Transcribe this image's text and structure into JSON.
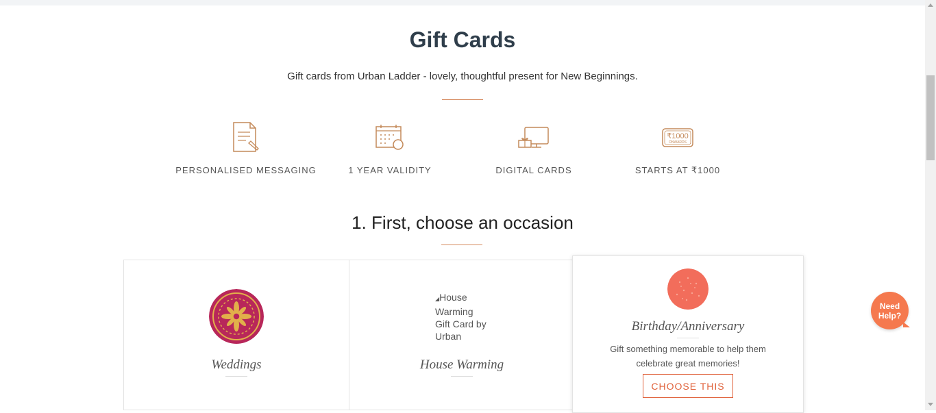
{
  "header": {
    "title": "Gift Cards",
    "subtitle": "Gift cards from Urban Ladder - lovely, thoughtful present for New Beginnings."
  },
  "features": [
    {
      "label": "PERSONALISED MESSAGING",
      "icon": "document-pen-icon"
    },
    {
      "label": "1 YEAR VALIDITY",
      "icon": "calendar-clock-icon"
    },
    {
      "label": "DIGITAL CARDS",
      "icon": "monitor-gift-icon"
    },
    {
      "label": "STARTS AT ₹1000",
      "icon": "price-tag-icon",
      "tag_text": "₹1000",
      "tag_sub": "ONWARDS"
    }
  ],
  "occasion": {
    "step_title": "1. First, choose an occasion",
    "cards": [
      {
        "name": "Weddings",
        "image_color": "#b8275a"
      },
      {
        "name": "House Warming",
        "image_alt": "House Warming Gift Card by Urban"
      },
      {
        "name": "Birthday/Anniversary",
        "description_line1": "Gift something memorable to help them",
        "description_line2": "celebrate great memories!",
        "button_label": "CHOOSE THIS",
        "image_color": "#f26d5b"
      }
    ]
  },
  "help": {
    "line1": "Need",
    "line2": "Help?"
  },
  "colors": {
    "accent": "#e0613a",
    "heading": "#2f3e4b",
    "icon": "#c48a5a"
  }
}
